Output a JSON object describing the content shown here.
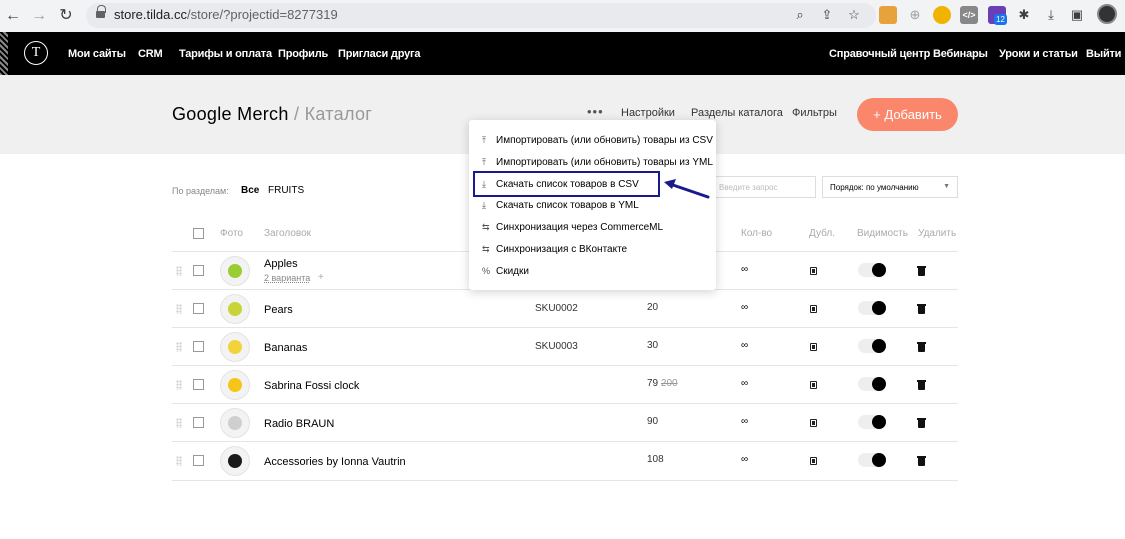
{
  "browser": {
    "url_host": "store.tilda.cc",
    "url_path": "/store/?projectid=8277319",
    "ext_badge": "12"
  },
  "topbar": {
    "logo": "T",
    "left_items": [
      "Мои сайты",
      "CRM",
      "Тарифы и оплата",
      "Профиль",
      "Пригласи друга"
    ],
    "right_items": [
      "Справочный центр",
      "Вебинары",
      "Уроки и статьи",
      "Выйти"
    ]
  },
  "header": {
    "project": "Google Merch",
    "separator": "/",
    "section": "Каталог",
    "dots": "•••",
    "links": [
      "Настройки",
      "Разделы каталога",
      "Фильтры"
    ],
    "add_button": "+  Добавить"
  },
  "filters": {
    "label": "По разделам:",
    "all": "Все",
    "fruits": "FRUITS",
    "search_placeholder": "Введите запрос",
    "sort_value": "Порядок: по умолчанию"
  },
  "columns": [
    "Фото",
    "Заголовок",
    "Кол-во",
    "Дубл.",
    "Видимость",
    "Удалить"
  ],
  "rows": [
    {
      "name": "Apples",
      "variants": "2 варианта",
      "plus": "+",
      "sku": "",
      "price": "",
      "old_price": "",
      "qty": "∞",
      "thumb_color": "#9acd32"
    },
    {
      "name": "Pears",
      "sku": "SKU0002",
      "price": "20",
      "old_price": "",
      "qty": "∞",
      "thumb_color": "#c8d43a"
    },
    {
      "name": "Bananas",
      "sku": "SKU0003",
      "price": "30",
      "old_price": "",
      "qty": "∞",
      "thumb_color": "#f2d33c"
    },
    {
      "name": "Sabrina Fossi clock",
      "sku": "",
      "price": "79",
      "old_price": "200",
      "qty": "∞",
      "thumb_color": "#f5c518"
    },
    {
      "name": "Radio BRAUN",
      "sku": "",
      "price": "90",
      "old_price": "",
      "qty": "∞",
      "thumb_color": "#cfcfcf"
    },
    {
      "name": "Accessories by Ionna Vautrin",
      "sku": "",
      "price": "108",
      "old_price": "",
      "qty": "∞",
      "thumb_color": "#1a1a1a"
    }
  ],
  "menu": {
    "items": [
      {
        "icon": "⤒",
        "label": "Импортировать (или обновить) товары из CSV"
      },
      {
        "icon": "⤒",
        "label": "Импортировать (или обновить) товары из YML"
      },
      {
        "icon": "⤓",
        "label": "Скачать список товаров в CSV"
      },
      {
        "icon": "⤓",
        "label": "Скачать список товаров в YML"
      },
      {
        "icon": "⇆",
        "label": "Синхронизация через CommerceML"
      },
      {
        "icon": "⇆",
        "label": "Синхронизация с ВКонтакте"
      },
      {
        "icon": "%",
        "label": "Скидки"
      }
    ]
  },
  "colors": {
    "accent": "#fa876b",
    "highlight": "#1a1a8c"
  }
}
